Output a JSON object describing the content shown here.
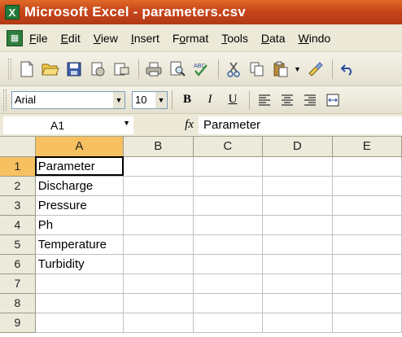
{
  "window": {
    "title": "Microsoft Excel - parameters.csv",
    "app_icon": "X"
  },
  "menu": {
    "items": [
      {
        "label": "File",
        "key": "F",
        "rest": "ile"
      },
      {
        "label": "Edit",
        "key": "E",
        "rest": "dit"
      },
      {
        "label": "View",
        "key": "V",
        "rest": "iew"
      },
      {
        "label": "Insert",
        "key": "I",
        "rest": "nsert"
      },
      {
        "label": "Format",
        "pre": "F",
        "key": "o",
        "rest": "rmat"
      },
      {
        "label": "Tools",
        "key": "T",
        "rest": "ools"
      },
      {
        "label": "Data",
        "key": "D",
        "rest": "ata"
      },
      {
        "label": "Window",
        "key": "W",
        "rest": "indo"
      }
    ]
  },
  "toolbar": {
    "icons": [
      "new-icon",
      "open-icon",
      "save-icon",
      "permission-icon",
      "email-icon",
      "print-icon",
      "print-preview-icon",
      "spelling-icon",
      "cut-icon",
      "copy-icon",
      "paste-icon",
      "format-painter-icon",
      "undo-icon"
    ]
  },
  "format": {
    "font": "Arial",
    "size": "10",
    "bold": "B",
    "italic": "I",
    "underline": "U"
  },
  "formula": {
    "namebox": "A1",
    "fx": "fx",
    "content": "Parameter"
  },
  "sheet": {
    "columns": [
      "A",
      "B",
      "C",
      "D",
      "E"
    ],
    "rows": [
      {
        "num": "1",
        "cells": [
          "Parameter",
          "",
          "",
          "",
          ""
        ]
      },
      {
        "num": "2",
        "cells": [
          "Discharge",
          "",
          "",
          "",
          ""
        ]
      },
      {
        "num": "3",
        "cells": [
          "Pressure",
          "",
          "",
          "",
          ""
        ]
      },
      {
        "num": "4",
        "cells": [
          "Ph",
          "",
          "",
          "",
          ""
        ]
      },
      {
        "num": "5",
        "cells": [
          "Temperature",
          "",
          "",
          "",
          ""
        ]
      },
      {
        "num": "6",
        "cells": [
          "Turbidity",
          "",
          "",
          "",
          ""
        ]
      },
      {
        "num": "7",
        "cells": [
          "",
          "",
          "",
          "",
          ""
        ]
      },
      {
        "num": "8",
        "cells": [
          "",
          "",
          "",
          "",
          ""
        ]
      },
      {
        "num": "9",
        "cells": [
          "",
          "",
          "",
          "",
          ""
        ]
      }
    ],
    "active_cell": "A1"
  }
}
